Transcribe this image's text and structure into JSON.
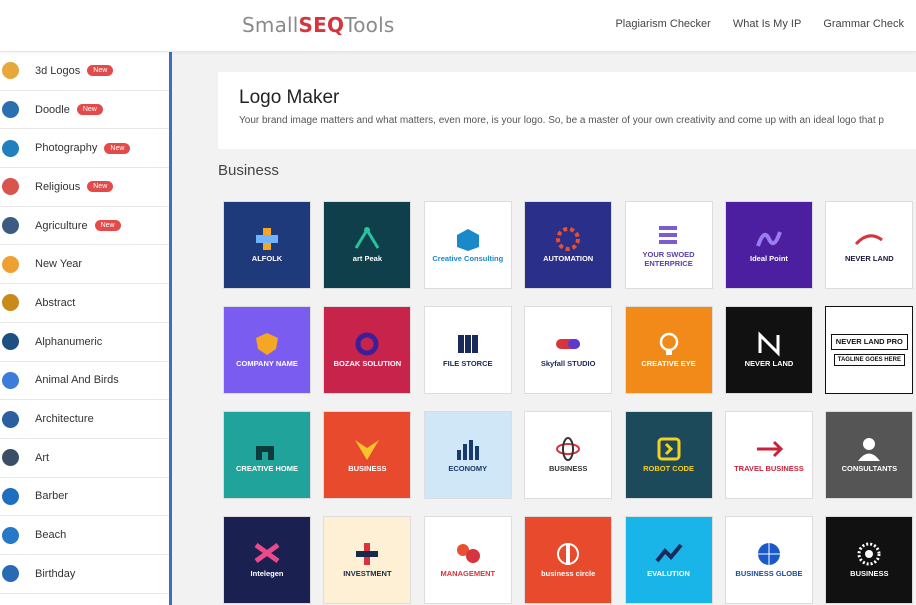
{
  "header": {
    "logo_small": "Small",
    "logo_seo": "SEQ",
    "logo_tools": "Tools",
    "nav": [
      "Plagiarism Checker",
      "What Is My IP",
      "Grammar Check"
    ]
  },
  "sidebar": {
    "badge_label": "New",
    "items": [
      {
        "label": "3d Logos",
        "new": true,
        "icon": "cube-icon",
        "color": "#e7a73a"
      },
      {
        "label": "Doodle",
        "new": true,
        "icon": "doodle-icon",
        "color": "#2c6fb0"
      },
      {
        "label": "Photography",
        "new": true,
        "icon": "camera-icon",
        "color": "#1f7fbf"
      },
      {
        "label": "Religious",
        "new": true,
        "icon": "religious-icon",
        "color": "#d9534f"
      },
      {
        "label": "Agriculture",
        "new": true,
        "icon": "plant-icon",
        "color": "#3d5a80"
      },
      {
        "label": "New Year",
        "new": false,
        "icon": "new-year-icon",
        "color": "#f0a030"
      },
      {
        "label": "Abstract",
        "new": false,
        "icon": "abstract-icon",
        "color": "#c98a1a"
      },
      {
        "label": "Alphanumeric",
        "new": false,
        "icon": "number-icon",
        "color": "#1e4f82"
      },
      {
        "label": "Animal And Birds",
        "new": false,
        "icon": "owl-icon",
        "color": "#3b7dd8"
      },
      {
        "label": "Architecture",
        "new": false,
        "icon": "building-icon",
        "color": "#2a5fa0"
      },
      {
        "label": "Art",
        "new": false,
        "icon": "palette-icon",
        "color": "#3a4f66"
      },
      {
        "label": "Barber",
        "new": false,
        "icon": "barber-icon",
        "color": "#1f6fc0"
      },
      {
        "label": "Beach",
        "new": false,
        "icon": "beach-icon",
        "color": "#2878c8"
      },
      {
        "label": "Birthday",
        "new": false,
        "icon": "cake-icon",
        "color": "#2a6ab5"
      }
    ]
  },
  "intro": {
    "title": "Logo Maker",
    "text": "Your brand image matters and what matters, even more, is your logo. So, be a master of your own creativity and come up with an ideal logo that p"
  },
  "section_title": "Business",
  "tiles": [
    {
      "label": "ALFOLK",
      "sub": "",
      "bg": "#1e3a7a",
      "fg": "#ffffff",
      "icon": "plus-icon",
      "accent": "#f5a623"
    },
    {
      "label": "art Peak",
      "sub": "",
      "bg": "#0f3f4a",
      "fg": "#ffffff",
      "icon": "peak-icon",
      "accent": "#27c4a0"
    },
    {
      "label": "Creative Consulting",
      "sub": "",
      "bg": "#ffffff",
      "fg": "#1a88c9",
      "icon": "cube-icon",
      "accent": "#1a88c9"
    },
    {
      "label": "AUTOMATION",
      "sub": "",
      "bg": "#2a2f8a",
      "fg": "#ffffff",
      "icon": "gear-icon",
      "accent": "#e8502f"
    },
    {
      "label": "YOUR SWOED ENTERPRICE",
      "sub": "",
      "bg": "#ffffff",
      "fg": "#5b3ea8",
      "icon": "flag-icon",
      "accent": "#7a5bd0"
    },
    {
      "label": "Ideal Point",
      "sub": "",
      "bg": "#4b1fa0",
      "fg": "#ffffff",
      "icon": "swirl-icon",
      "accent": "#9a7cf0"
    },
    {
      "label": "NEVER LAND",
      "sub": "",
      "bg": "#ffffff",
      "fg": "#1a1a3a",
      "icon": "wave-icon",
      "accent": "#d6353e"
    },
    {
      "label": "COMPANY NAME",
      "sub": "",
      "bg": "#7b5cf0",
      "fg": "#ffffff",
      "icon": "shield-icon",
      "accent": "#f5a623"
    },
    {
      "label": "BOZAK SOLUTION",
      "sub": "",
      "bg": "#c8234a",
      "fg": "#ffffff",
      "icon": "ring-icon",
      "accent": "#3b1f9a"
    },
    {
      "label": "FILE STORCE",
      "sub": "",
      "bg": "#ffffff",
      "fg": "#1a2a5a",
      "icon": "files-icon",
      "accent": "#1a2a5a"
    },
    {
      "label": "Skyfall STUDIO",
      "sub": "",
      "bg": "#ffffff",
      "fg": "#1a2a5a",
      "icon": "pill-icon",
      "accent": "#d6353e"
    },
    {
      "label": "CREATIVE EYE",
      "sub": "",
      "bg": "#f28a1a",
      "fg": "#ffffff",
      "icon": "bulb-icon",
      "accent": "#ffffff"
    },
    {
      "label": "NEVER LAND",
      "sub": "",
      "bg": "#111111",
      "fg": "#ffffff",
      "icon": "n-icon",
      "accent": "#ffffff"
    },
    {
      "label": "NEVER LAND PRO",
      "sub": "TAGLINE GOES HERE",
      "bg": "#ffffff",
      "fg": "#111111",
      "icon": "",
      "accent": "#111111"
    },
    {
      "label": "CREATIVE HOME",
      "sub": "",
      "bg": "#1fa39a",
      "fg": "#ffffff",
      "icon": "home-icon",
      "accent": "#0d3a3a"
    },
    {
      "label": "BUSINESS",
      "sub": "",
      "bg": "#e84a2e",
      "fg": "#ffffff",
      "icon": "eagle-icon",
      "accent": "#f5c42a"
    },
    {
      "label": "ECONOMY",
      "sub": "",
      "bg": "#cfe7f7",
      "fg": "#1a3a6a",
      "icon": "bars-icon",
      "accent": "#1a3a6a"
    },
    {
      "label": "BUSINESS",
      "sub": "",
      "bg": "#ffffff",
      "fg": "#333333",
      "icon": "atom-icon",
      "accent": "#d6353e"
    },
    {
      "label": "ROBOT CODE",
      "sub": "",
      "bg": "#1d4a5a",
      "fg": "#f5d020",
      "icon": "code-icon",
      "accent": "#f5d020"
    },
    {
      "label": "TRAVEL BUSINESS",
      "sub": "",
      "bg": "#ffffff",
      "fg": "#c8233a",
      "icon": "plane-icon",
      "accent": "#c8233a"
    },
    {
      "label": "CONSULTANTS",
      "sub": "",
      "bg": "#555555",
      "fg": "#ffffff",
      "icon": "person-icon",
      "accent": "#ffffff"
    },
    {
      "label": "Intelegen",
      "sub": "",
      "bg": "#1a2050",
      "fg": "#ffffff",
      "icon": "infinity-icon",
      "accent": "#e84a8a"
    },
    {
      "label": "INVESTMENT",
      "sub": "",
      "bg": "#fdf0d5",
      "fg": "#1a2a4a",
      "icon": "cross-icon",
      "accent": "#d6353e"
    },
    {
      "label": "MANAGEMENT",
      "sub": "",
      "bg": "#ffffff",
      "fg": "#d6353e",
      "icon": "people-icon",
      "accent": "#e8502f"
    },
    {
      "label": "business circle",
      "sub": "",
      "bg": "#e84a2e",
      "fg": "#ffffff",
      "icon": "circle-icon",
      "accent": "#ffffff"
    },
    {
      "label": "EVALUTION",
      "sub": "",
      "bg": "#19b5e8",
      "fg": "#ffffff",
      "icon": "arrow-icon",
      "accent": "#1a2a5a"
    },
    {
      "label": "BUSINESS GLOBE",
      "sub": "",
      "bg": "#ffffff",
      "fg": "#1a4a9a",
      "icon": "globe-icon",
      "accent": "#1a5ac8"
    },
    {
      "label": "BUSINESS",
      "sub": "",
      "bg": "#111111",
      "fg": "#ffffff",
      "icon": "dots-icon",
      "accent": "#ffffff"
    }
  ]
}
